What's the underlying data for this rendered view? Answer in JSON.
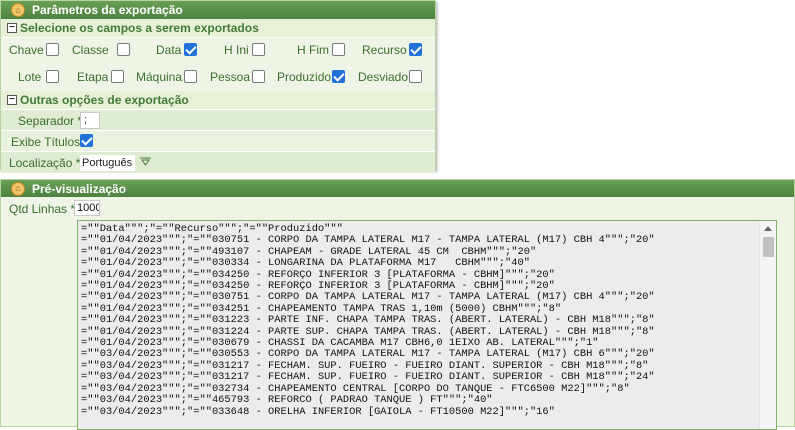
{
  "export_panel": {
    "title": "Parâmetros da exportação",
    "fields_section": "Selecione os campos a serem exportados",
    "fields_row1": [
      {
        "label": "Chave",
        "checked": false
      },
      {
        "label": "Classe",
        "checked": false
      },
      {
        "label": "Data",
        "checked": true
      },
      {
        "label": "H Ini",
        "checked": false
      },
      {
        "label": "H Fim",
        "checked": false
      },
      {
        "label": "Recurso",
        "checked": true
      }
    ],
    "fields_row2": [
      {
        "label": "Lote",
        "checked": false
      },
      {
        "label": "Etapa",
        "checked": false
      },
      {
        "label": "Máquina",
        "checked": false
      },
      {
        "label": "Pessoa",
        "checked": false
      },
      {
        "label": "Produzido",
        "checked": true
      },
      {
        "label": "Desviado",
        "checked": false
      }
    ],
    "other_section": "Outras opções de exportação",
    "separator_label": "Separador *",
    "separator_value": ";",
    "titles_label": "Exibe Títulos",
    "titles_checked": true,
    "locale_label": "Localização *",
    "locale_value": "Português"
  },
  "preview_panel": {
    "title": "Pré-visualização",
    "qtd_label": "Qtd Linhas *",
    "qtd_value": "1000",
    "lines": [
      "=\"\"Data\"\"\";\"=\"\"Recurso\"\"\";\"=\"\"Produzido\"\"\"",
      "=\"\"01/04/2023\"\"\";\"=\"\"030751 - CORPO DA TAMPA LATERAL M17 - TAMPA LATERAL (M17) CBH 4\"\"\";\"20\"",
      "=\"\"01/04/2023\"\"\";\"=\"\"493107 - CHAPEAM - GRADE LATERAL 45 CM  CBHM\"\"\";\"20\"",
      "=\"\"01/04/2023\"\"\";\"=\"\"030334 - LONGARINA DA PLATAFORMA M17   CBHM\"\"\";\"40\"",
      "=\"\"01/04/2023\"\"\";\"=\"\"034250 - REFORÇO INFERIOR 3 [PLATAFORMA - CBHM]\"\"\";\"20\"",
      "=\"\"01/04/2023\"\"\";\"=\"\"034250 - REFORÇO INFERIOR 3 [PLATAFORMA - CBHM]\"\"\";\"20\"",
      "=\"\"01/04/2023\"\"\";\"=\"\"030751 - CORPO DA TAMPA LATERAL M17 - TAMPA LATERAL (M17) CBH 4\"\"\";\"20\"",
      "=\"\"01/04/2023\"\"\";\"=\"\"034251 - CHAPEAMENTO TAMPA TRAS 1,10m (5000) CBHM\"\"\";\"8\"",
      "=\"\"01/04/2023\"\"\";\"=\"\"031223 - PARTE INF. CHAPA TAMPA TRAS. (ABERT. LATERAL) - CBH M18\"\"\";\"8\"",
      "=\"\"01/04/2023\"\"\";\"=\"\"031224 - PARTE SUP. CHAPA TAMPA TRAS. (ABERT. LATERAL) - CBH M18\"\"\";\"8\"",
      "=\"\"01/04/2023\"\"\";\"=\"\"030679 - CHASSI DA CACAMBA M17 CBH6,0 1EIXO AB. LATERAL\"\"\";\"1\"",
      "=\"\"03/04/2023\"\"\";\"=\"\"030553 - CORPO DA TAMPA LATERAL M17 - TAMPA LATERAL (M17) CBH 6\"\"\";\"20\"",
      "=\"\"03/04/2023\"\"\";\"=\"\"031217 - FECHAM. SUP. FUEIRO - FUEIRO DIANT. SUPERIOR - CBH M18\"\"\";\"8\"",
      "=\"\"03/04/2023\"\"\";\"=\"\"031217 - FECHAM. SUP. FUEIRO - FUEIRO DIANT. SUPERIOR - CBH M18\"\"\";\"24\"",
      "=\"\"03/04/2023\"\"\";\"=\"\"032734 - CHAPEAMENTO CENTRAL [CORPO DO TANQUE - FTC6500 M22]\"\"\";\"8\"",
      "=\"\"03/04/2023\"\"\";\"=\"\"465793 - REFORCO ( PADRAO TANQUE ) FT\"\"\";\"40\"",
      "=\"\"03/04/2023\"\"\";\"=\"\"033648 - ORELHA INFERIOR [GAIOLA - FT10500 M22]\"\"\";\"16\""
    ]
  }
}
